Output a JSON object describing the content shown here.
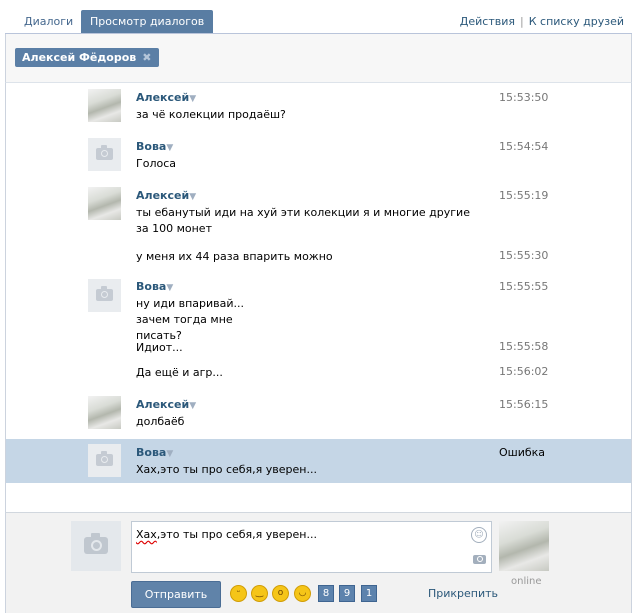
{
  "tabs": [
    {
      "label": "Диалоги",
      "selected": false
    },
    {
      "label": "Просмотр диалогов",
      "selected": true
    }
  ],
  "actions": {
    "actions_label": "Действия",
    "separator": "|",
    "friends_label": "К списку друзей"
  },
  "peer_chip": {
    "name": "Алексей Фёдоров"
  },
  "messages": [
    {
      "author": "Алексей",
      "time": "15:53:50",
      "text": "за чё колекции продаёш?",
      "avatar": "photo"
    },
    {
      "author": "Вова",
      "time": "15:54:54",
      "text": "Голоса",
      "avatar": "camera"
    },
    {
      "author": "Алексей",
      "time": "15:55:19",
      "text": "ты ебанутый иди на хуй эти колекции я и многие другие за 100 монет",
      "avatar": "photo"
    },
    {
      "author": "",
      "time": "15:55:30",
      "text": "у меня их 44 раза впарить можно"
    },
    {
      "author": "Вова",
      "time": "15:55:55",
      "text": "ну иди впаривай... зачем тогда мне писать?",
      "avatar": "camera"
    },
    {
      "author": "",
      "time": "15:55:58",
      "text": "Идиот..."
    },
    {
      "author": "",
      "time": "15:56:02",
      "text": "Да ещё и агр..."
    },
    {
      "author": "Алексей",
      "time": "15:56:15",
      "text": "долбаёб",
      "avatar": "photo"
    },
    {
      "author": "Вова",
      "time": "Ошибка",
      "text": "Хах,это ты про себя,я уверен...",
      "avatar": "camera",
      "error": true
    }
  ],
  "compose": {
    "draft_word1": "Хах",
    "draft_rest": ",это ты про себя,я уверен...",
    "send_label": "Отправить",
    "attach_label": "Прикрепить",
    "online_label": "online",
    "emoji_keys": [
      "8",
      "9",
      "1"
    ],
    "smile_icon": "smile-icon",
    "camera_icon": "camera-icon"
  },
  "colors": {
    "accent": "#597da3",
    "link": "#2b587a",
    "error_row": "#c5d6e6"
  }
}
